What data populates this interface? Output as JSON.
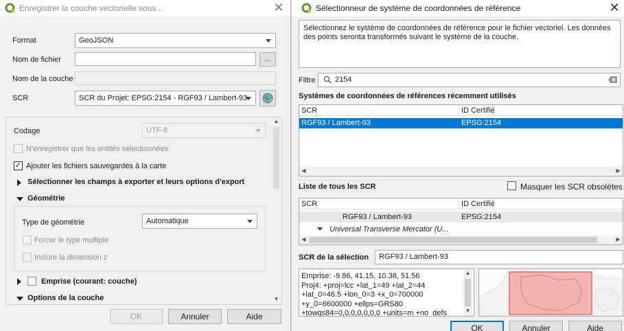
{
  "left_dialog": {
    "title": "Enregistrer la couche vectorielle sous...",
    "format_label": "Format",
    "format_value": "GeoJSON",
    "filename_label": "Nom de fichier",
    "filename_value": "",
    "browse_label": "...",
    "layer_name_label": "Nom de la couche",
    "layer_name_value": "",
    "crs_label": "SCR",
    "crs_value": "SCR du Projet: EPSG:2154 - RGF93 / Lambert-93",
    "encoding_label": "Codage",
    "encoding_value": "UTF-8",
    "only_selected_label": "N'enregistrer que les entités sélectionnées",
    "add_to_map_label": "Ajouter les fichiers sauvegardés à la carte",
    "select_fields_label": "Sélectionner les champs à exporter et leurs options d'export",
    "geometry_label": "Géométrie",
    "geometry_type_label": "Type de géométrie",
    "geometry_type_value": "Automatique",
    "force_multi_label": "Forcer le type multiple",
    "include_z_label": "Inclure la dimension z",
    "extent_label": "Emprise (courant: couche)",
    "layer_options_label": "Options de la couche",
    "ok_label": "OK",
    "cancel_label": "Annuler",
    "help_label": "Aide"
  },
  "right_dialog": {
    "title": "Sélectionneur de système de coordonnées de référence",
    "description": "Sélectionnez le système de coordonnées de référence pour le fichier vectoriel. Les données des points seronta transformés suivant le système de la couche.",
    "filter_label": "Filtre",
    "filter_value": "2154",
    "recent_title": "Systèmes de coordonnées de références récemment utilisés",
    "col_scr": "SCR",
    "col_id": "ID Certifié",
    "recent_rows": [
      {
        "scr": "RGF93 / Lambert-93",
        "id": "EPSG:2154"
      }
    ],
    "all_title": "Liste de tous les SCR",
    "hide_obsolete_label": "Masquer les SCR obsolètes",
    "all_rows": [
      {
        "scr": "RGF93 / Lambert-93",
        "id": "EPSG:2154"
      },
      {
        "scr": "Universal Transverse Mercator (U...",
        "id": ""
      }
    ],
    "selection_label": "SCR de la sélection",
    "selection_value": "RGF93 / Lambert-93",
    "details": [
      "Emprise: -9.86, 41.15, 10.38, 51.56",
      "Proj4: +proj=lcc +lat_1=49 +lat_2=44",
      "+lat_0=46.5 +lon_0=3 +x_0=700000",
      "+y_0=6600000 +ellps=GRS80",
      "+towgs84=0,0,0,0,0,0,0 +units=m +no_defs"
    ],
    "ok_label": "OK",
    "cancel_label": "Annuler",
    "help_label": "Aide"
  },
  "colors": {
    "accent": "#0078d7",
    "qgis_green": "#589632",
    "qgis_yellow": "#eebe2a",
    "extent_fill": "#f4a0a0",
    "extent_border": "#e05050"
  }
}
